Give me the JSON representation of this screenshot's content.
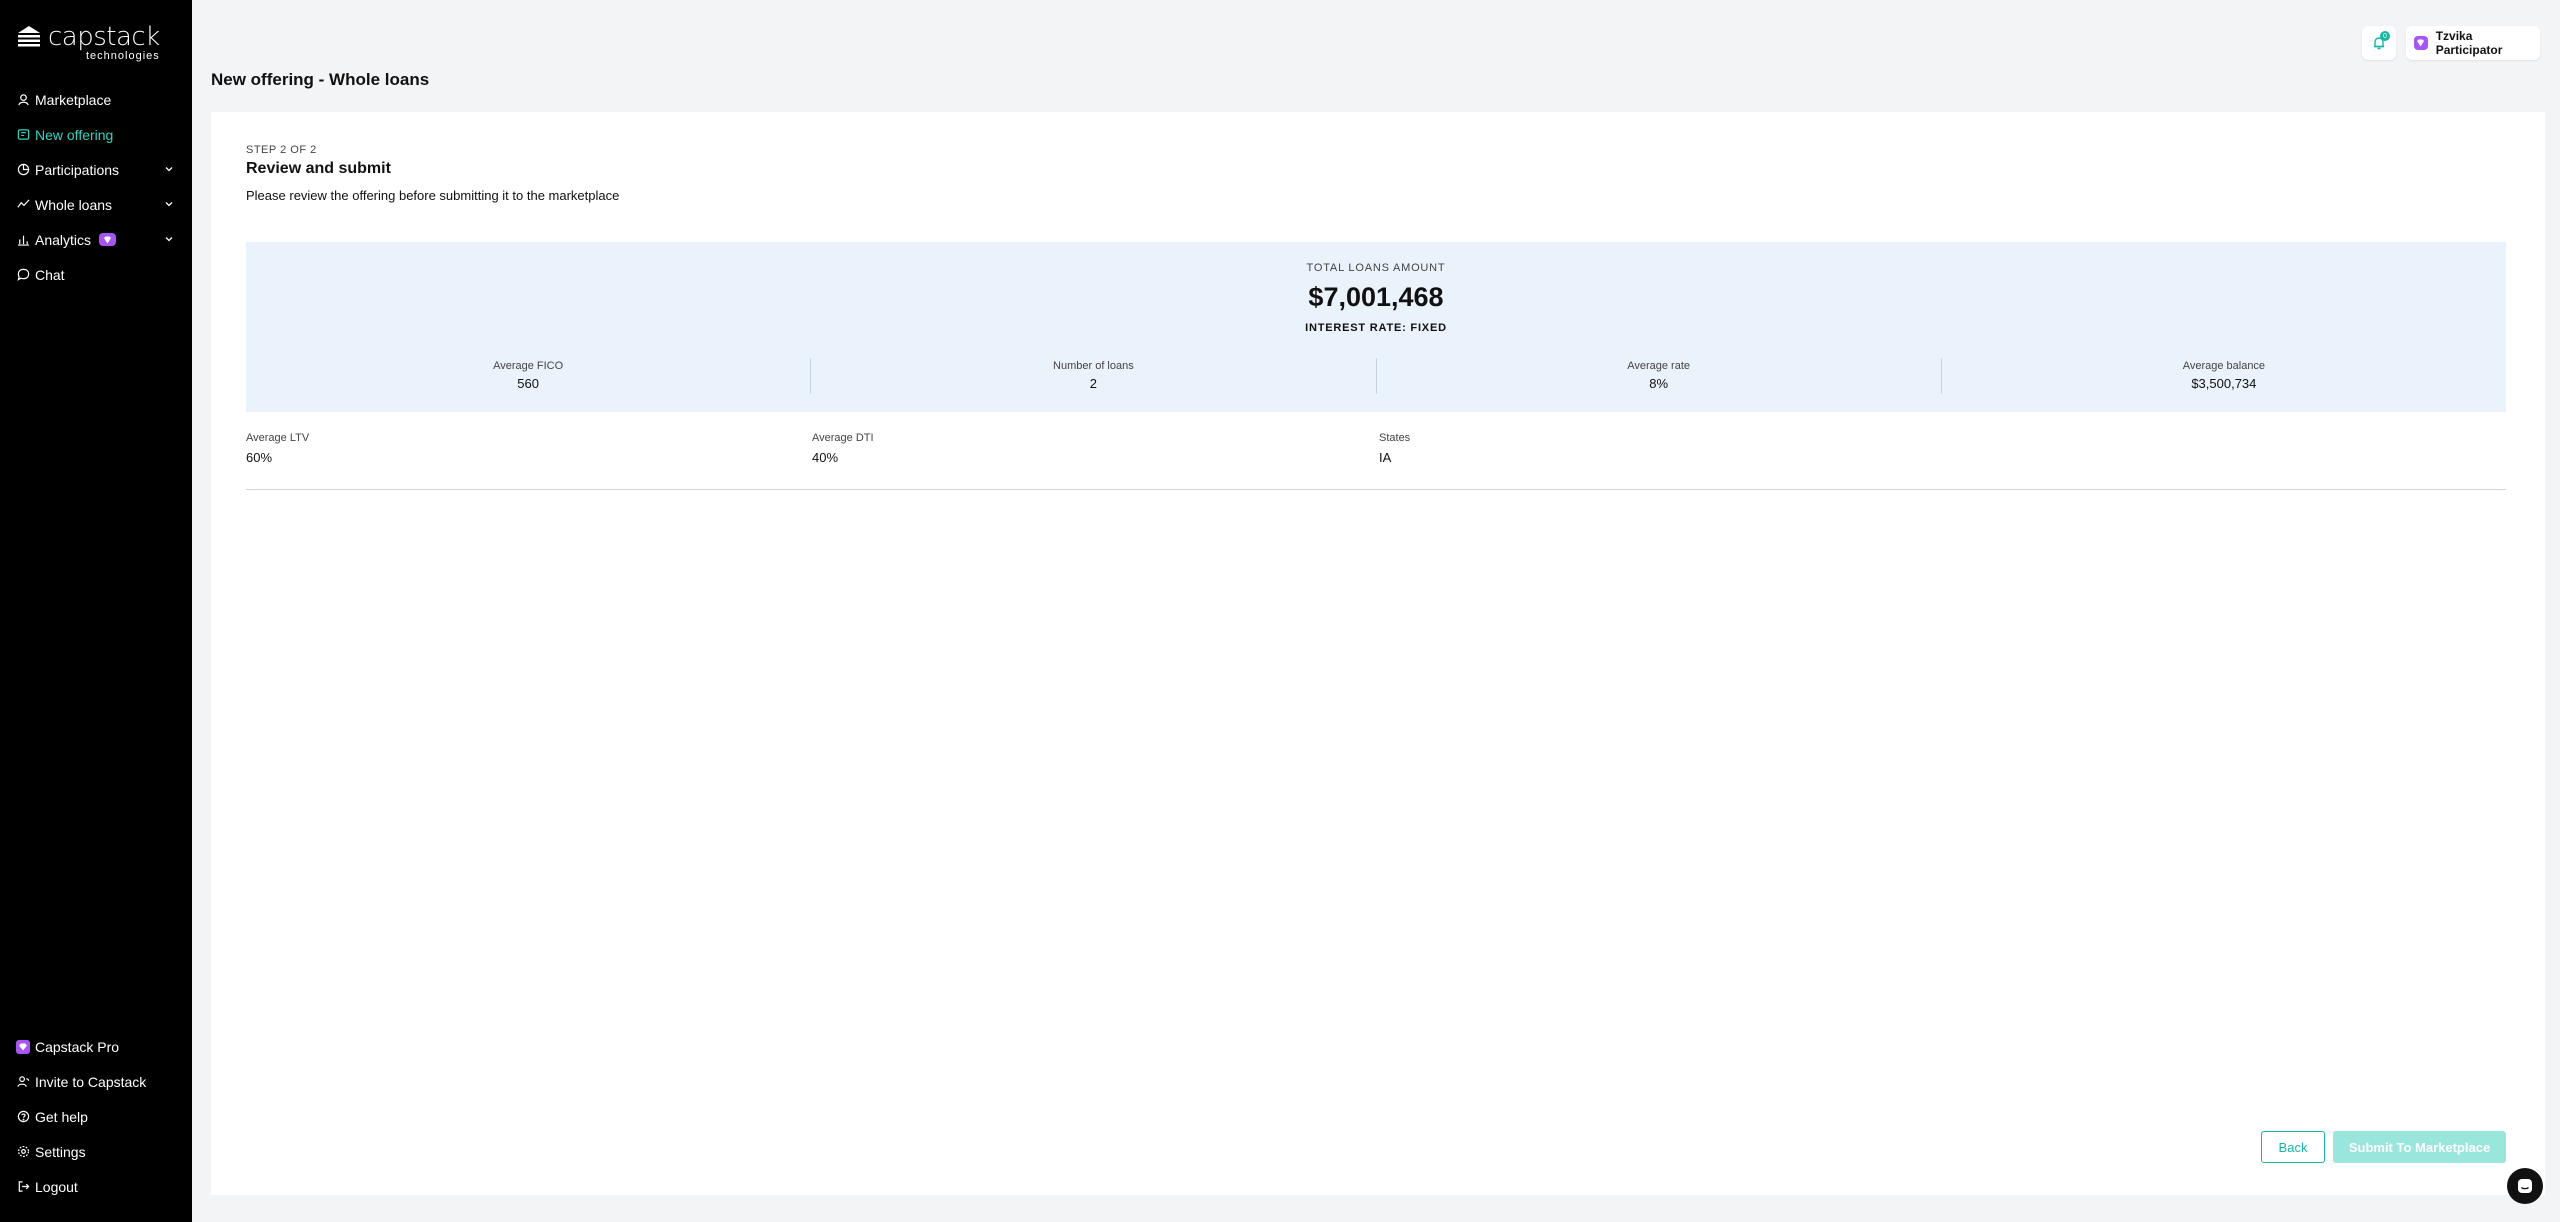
{
  "brand": {
    "name": "capstack",
    "sub": "technologies"
  },
  "sidebar": {
    "items": [
      {
        "label": "Marketplace",
        "icon": "marketplace-icon"
      },
      {
        "label": "New offering",
        "icon": "new-offering-icon",
        "active": true
      },
      {
        "label": "Participations",
        "icon": "participations-icon",
        "expandable": true
      },
      {
        "label": "Whole loans",
        "icon": "whole-loans-icon",
        "expandable": true
      },
      {
        "label": "Analytics",
        "icon": "analytics-icon",
        "expandable": true,
        "pro": true
      },
      {
        "label": "Chat",
        "icon": "chat-icon"
      }
    ],
    "bottom": [
      {
        "label": "Capstack Pro",
        "icon": "pro-icon"
      },
      {
        "label": "Invite to Capstack",
        "icon": "invite-icon"
      },
      {
        "label": "Get help",
        "icon": "help-icon"
      },
      {
        "label": "Settings",
        "icon": "settings-icon"
      },
      {
        "label": "Logout",
        "icon": "logout-icon"
      }
    ]
  },
  "topbar": {
    "notification_count": "0",
    "user_name": "Tzvika Participator"
  },
  "page": {
    "title": "New offering - Whole loans"
  },
  "step": {
    "label": "STEP 2 OF 2",
    "title": "Review and submit",
    "subtitle": "Please review the offering before submitting it to the marketplace"
  },
  "summary": {
    "total_label": "TOTAL LOANS AMOUNT",
    "total_value": "$7,001,468",
    "rate_label": "INTEREST RATE: FIXED",
    "stats": [
      {
        "label": "Average FICO",
        "value": "560"
      },
      {
        "label": "Number of loans",
        "value": "2"
      },
      {
        "label": "Average rate",
        "value": "8%"
      },
      {
        "label": "Average balance",
        "value": "$3,500,734"
      }
    ]
  },
  "details": [
    {
      "label": "Average LTV",
      "value": "60%"
    },
    {
      "label": "Average DTI",
      "value": "40%"
    },
    {
      "label": "States",
      "value": "IA"
    }
  ],
  "actions": {
    "back": "Back",
    "submit": "Submit To Marketplace"
  },
  "colors": {
    "accent": "#14b8a6",
    "pro": "#a855f7",
    "summary_bg": "#eaf2fb",
    "submit_disabled": "#99e6dc"
  }
}
